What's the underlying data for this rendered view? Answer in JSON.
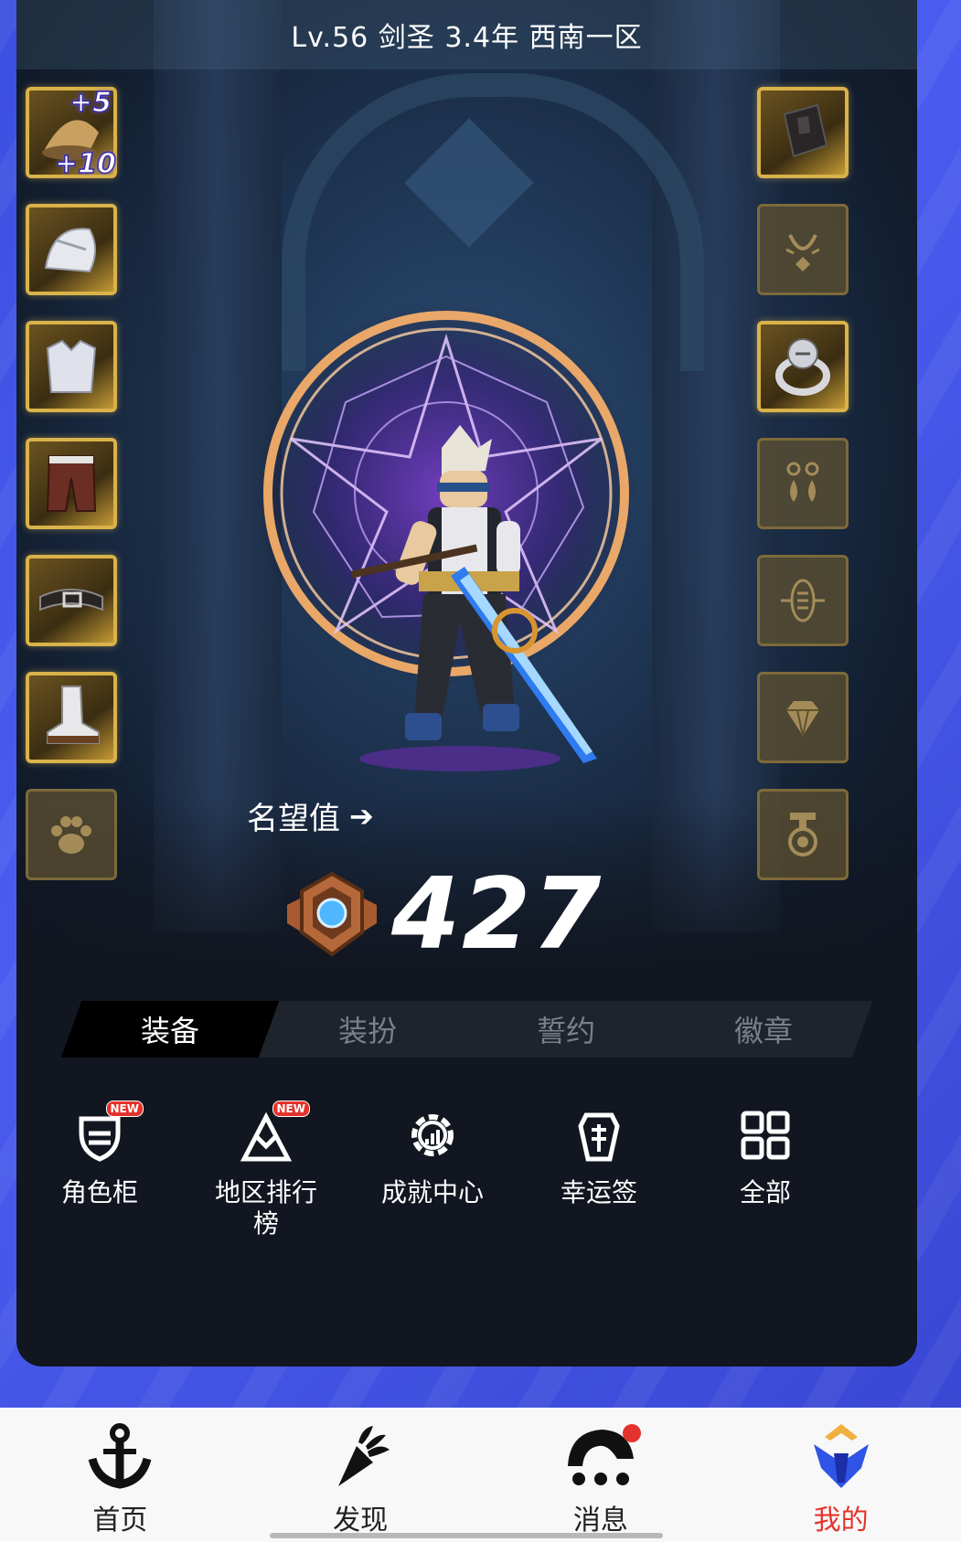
{
  "header": {
    "title": "Lv.56 剑圣 3.4年 西南一区"
  },
  "equipment": {
    "left_slots": [
      {
        "name": "hat-slot",
        "plus_upgrade": "+5",
        "plus_enhance": "+10"
      },
      {
        "name": "shoulder-slot"
      },
      {
        "name": "top-slot"
      },
      {
        "name": "pants-slot"
      },
      {
        "name": "belt-slot"
      },
      {
        "name": "shoes-slot"
      },
      {
        "name": "pet-slot"
      }
    ],
    "right_slots": [
      {
        "name": "bracelet-slot"
      },
      {
        "name": "necklace-slot"
      },
      {
        "name": "ring-slot"
      },
      {
        "name": "earring-slot"
      },
      {
        "name": "subweapon-slot"
      },
      {
        "name": "gem-slot"
      },
      {
        "name": "title-slot"
      }
    ]
  },
  "fame": {
    "label": "名望值",
    "value": "427"
  },
  "tabs": [
    {
      "label": "装备",
      "active": true
    },
    {
      "label": "装扮",
      "active": false
    },
    {
      "label": "誓约",
      "active": false
    },
    {
      "label": "徽章",
      "active": false
    }
  ],
  "quick_actions": [
    {
      "label": "角色柜",
      "badge": "NEW",
      "icon": "character-cabinet-icon"
    },
    {
      "label": "地区排行榜",
      "badge": "NEW",
      "icon": "region-ranking-icon"
    },
    {
      "label": "成就中心",
      "badge": "",
      "icon": "achievement-gear-icon"
    },
    {
      "label": "幸运签",
      "badge": "",
      "icon": "lucky-draw-icon"
    },
    {
      "label": "全部",
      "badge": "",
      "icon": "grid-all-icon"
    }
  ],
  "bottom_nav": [
    {
      "label": "首页",
      "icon": "anchor-icon",
      "active": false
    },
    {
      "label": "发现",
      "icon": "discover-icon",
      "active": false
    },
    {
      "label": "消息",
      "icon": "message-icon",
      "active": false,
      "dot": true
    },
    {
      "label": "我的",
      "icon": "profile-emblem-icon",
      "active": true
    }
  ],
  "colors": {
    "accent": "#e4332c",
    "gold": "#d9b24a",
    "brand_blue": "#3b4fe0"
  }
}
